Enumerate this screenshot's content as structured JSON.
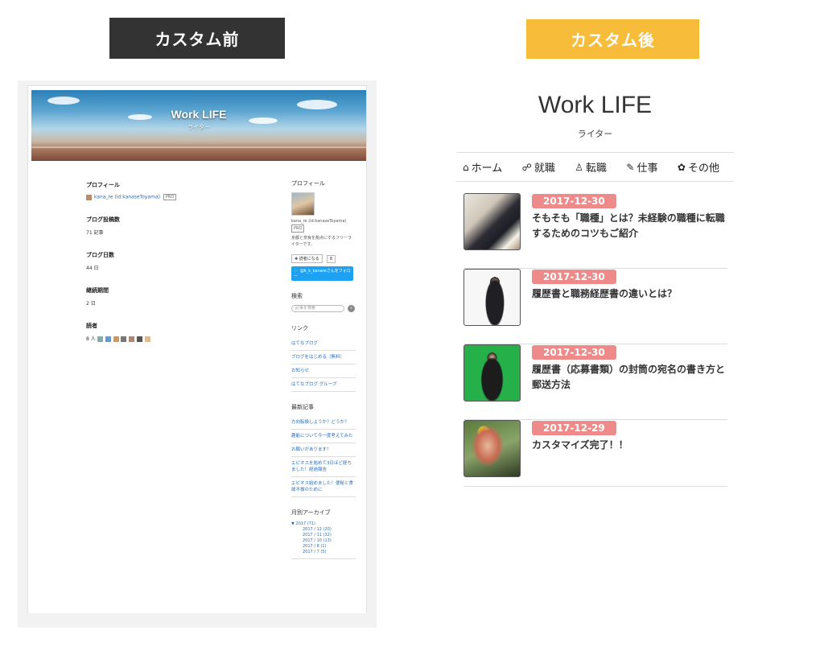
{
  "labels": {
    "before": "カスタム前",
    "after": "カスタム後"
  },
  "before": {
    "blog_title": "Work LIFE",
    "blog_subtitle": "ライター",
    "main": {
      "profile_heading": "プロフィール",
      "profile_user": "kana_re (id:kanaseToyama)",
      "pro_badge": "PRO",
      "posts_heading": "ブログ投稿数",
      "posts_value": "71 記事",
      "days_heading": "ブログ日数",
      "days_value": "44 日",
      "streak_heading": "継続期間",
      "streak_value": "2 日",
      "readers_heading": "読者",
      "readers_value": "8 人"
    },
    "sidebar": {
      "profile_heading": "プロフィール",
      "profile_id": "kana_re (id:kanaseToyama)",
      "pro_badge": "PRO",
      "bio": "京都と奈良を拠点にするフリーライターです。",
      "reader_button": "読者になる",
      "reader_count": "8",
      "twitter_button": "@k_k_kanareさんをフォロー",
      "search_heading": "検索",
      "search_placeholder": "記事を検索",
      "links_heading": "リンク",
      "links": [
        "はてなブログ",
        "ブログをはじめる（無料）",
        "お知らせ",
        "はてなブログ グループ"
      ],
      "recent_heading": "最新記事",
      "recent": [
        "方向転換しようか？どうか？",
        "趣能について今一度考えてみた",
        "お願いがあります！",
        "エピオスを始めて3日ほど経ちました！経過報告",
        "エピオス始めました！便秘と食欲不振のために"
      ],
      "archive_heading": "月別アーカイブ",
      "archive_year": "▼ 2017 (71)",
      "archive_months": [
        "2017 / 12 (20)",
        "2017 / 11 (32)",
        "2017 / 10 (13)",
        "2017 / 8 (1)",
        "2017 / 7 (5)"
      ]
    }
  },
  "after": {
    "blog_title": "Work LIFE",
    "blog_subtitle": "ライター",
    "nav": [
      {
        "icon": "home-icon",
        "glyph": "⌂",
        "label": "ホーム"
      },
      {
        "icon": "handshake-icon",
        "glyph": "☍",
        "label": "就職"
      },
      {
        "icon": "user-icon",
        "glyph": "♙",
        "label": "転職"
      },
      {
        "icon": "edit-icon",
        "glyph": "✎",
        "label": "仕事"
      },
      {
        "icon": "paw-icon",
        "glyph": "✿",
        "label": "その他"
      }
    ],
    "posts": [
      {
        "date": "2017-12-30",
        "title": "そもそも「職種」とは？未経験の職種に転職するためのコツもご紹介"
      },
      {
        "date": "2017-12-30",
        "title": "履歴書と職務経歴書の違いとは？"
      },
      {
        "date": "2017-12-30",
        "title": "履歴書（応募書類）の封筒の宛名の書き方と郵送方法"
      },
      {
        "date": "2017-12-29",
        "title": "カスタマイズ完了！！"
      }
    ]
  }
}
